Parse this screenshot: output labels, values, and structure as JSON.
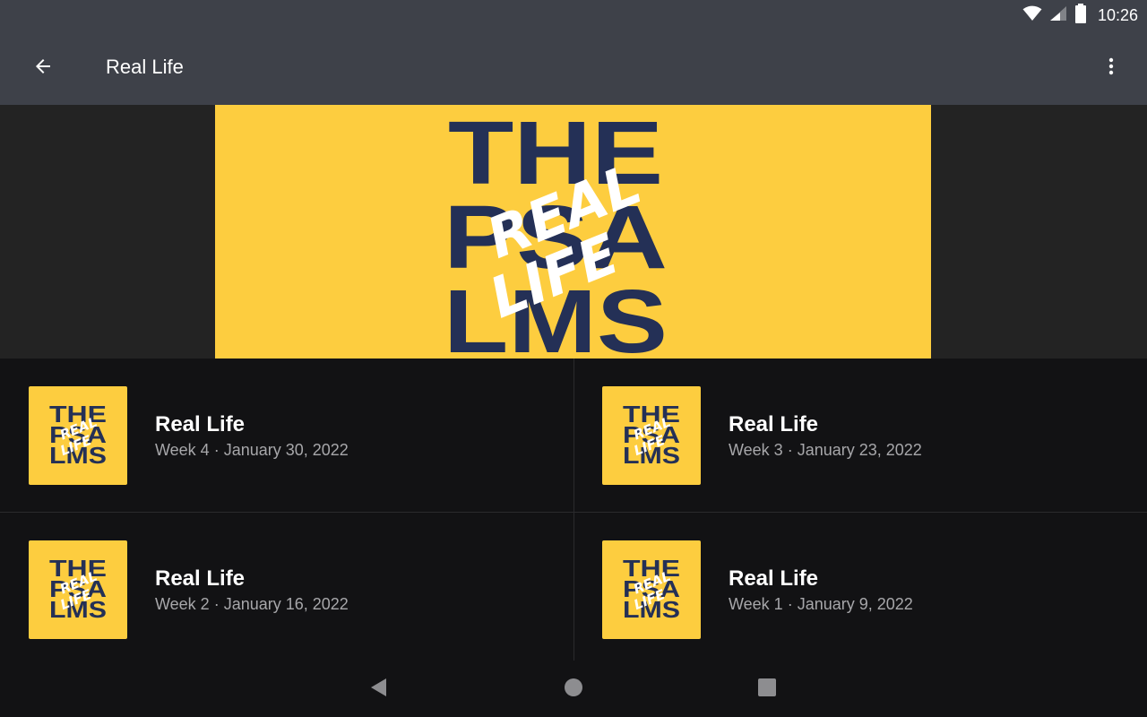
{
  "status_bar": {
    "time": "10:26",
    "icons": [
      "wifi-icon",
      "cellular-signal-icon",
      "battery-icon"
    ]
  },
  "app_bar": {
    "title": "Real Life",
    "back_icon": "arrow-back-icon",
    "menu_icon": "more-vert-icon"
  },
  "hero": {
    "art_lines": [
      "THE",
      "PSA",
      "LMS"
    ],
    "art_overlay": [
      "REAL",
      "LIFE"
    ]
  },
  "episodes": [
    {
      "title": "Real Life",
      "subtitle": "Week 4 · January 30, 2022"
    },
    {
      "title": "Real Life",
      "subtitle": "Week 3 · January 23, 2022"
    },
    {
      "title": "Real Life",
      "subtitle": "Week 2 · January 16, 2022"
    },
    {
      "title": "Real Life",
      "subtitle": "Week 1 · January 9, 2022"
    }
  ],
  "nav_bar": {
    "icons": [
      "nav-back-icon",
      "nav-home-icon",
      "nav-recents-icon"
    ]
  },
  "colors": {
    "app_bar": "#3e4149",
    "background": "#121214",
    "hero_background": "#232323",
    "artwork_yellow": "#fdcd3f",
    "artwork_navy": "#243056",
    "subtitle_text": "#a7a7aa"
  }
}
